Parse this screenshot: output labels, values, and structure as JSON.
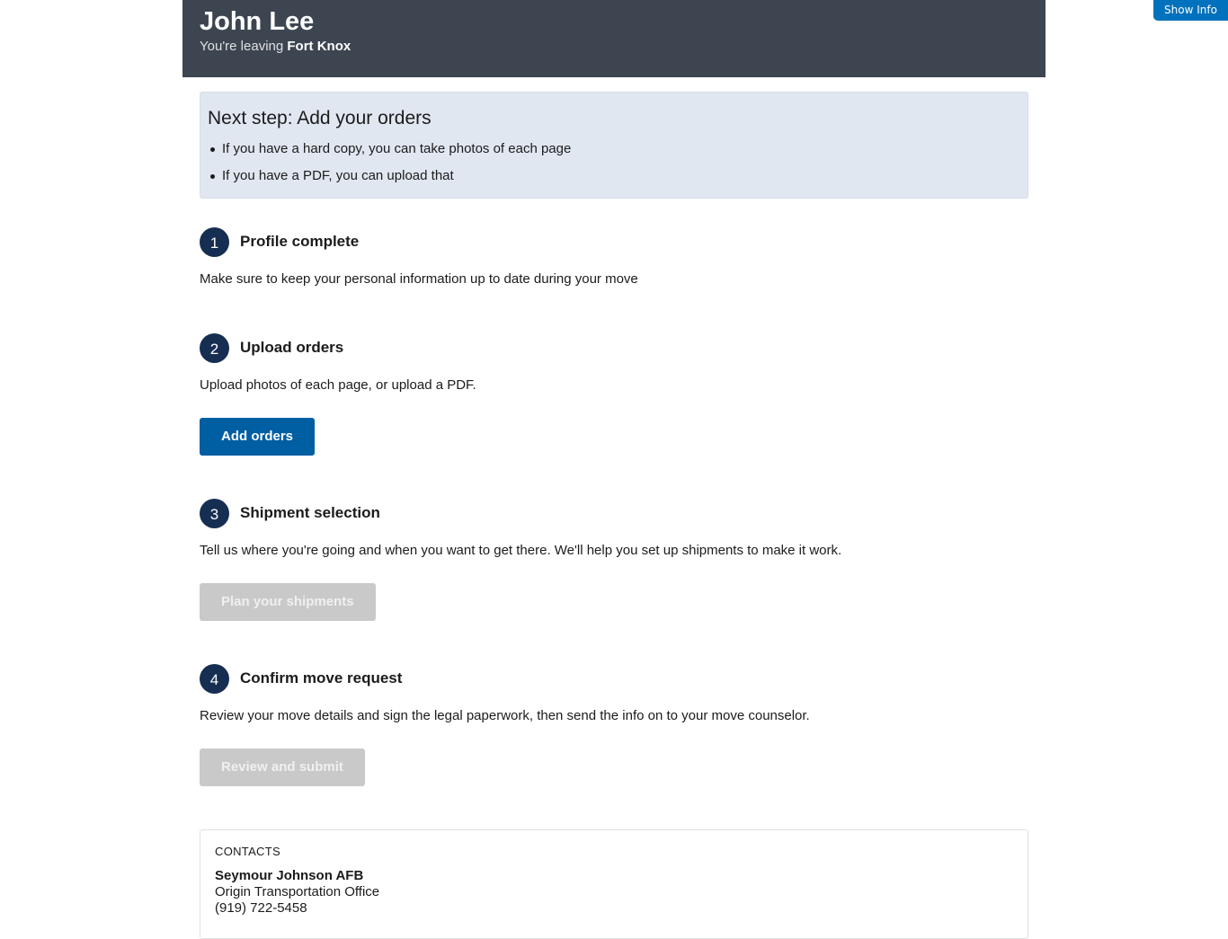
{
  "show_info_label": "Show Info",
  "header": {
    "name": "John Lee",
    "leaving_prefix": "You're leaving",
    "origin": "Fort Knox"
  },
  "alert": {
    "title": "Next step: Add your orders",
    "items": [
      "If you have a hard copy, you can take photos of each page",
      "If you have a PDF, you can upload that"
    ]
  },
  "steps": [
    {
      "number": "1",
      "title": "Profile complete",
      "description": "Make sure to keep your personal information up to date during your move"
    },
    {
      "number": "2",
      "title": "Upload orders",
      "description": "Upload photos of each page, or upload a PDF.",
      "button": "Add orders",
      "button_enabled": true
    },
    {
      "number": "3",
      "title": "Shipment selection",
      "description": "Tell us where you're going and when you want to get there. We'll help you set up shipments to make it work.",
      "button": "Plan your shipments",
      "button_enabled": false
    },
    {
      "number": "4",
      "title": "Confirm move request",
      "description": "Review your move details and sign the legal paperwork, then send the info on to your move counselor.",
      "button": "Review and submit",
      "button_enabled": false
    }
  ],
  "contacts": {
    "label": "Contacts",
    "office_name": "Seymour Johnson AFB",
    "office_type": "Origin Transportation Office",
    "phone": "(919) 722-5458"
  },
  "colors": {
    "header_bg": "#3d4551",
    "primary": "#005ea2",
    "step_number_bg": "#162e51",
    "alert_bg": "#e1e7f1",
    "disabled_bg": "#c9c9c9",
    "show_info_bg": "#0071bc"
  }
}
